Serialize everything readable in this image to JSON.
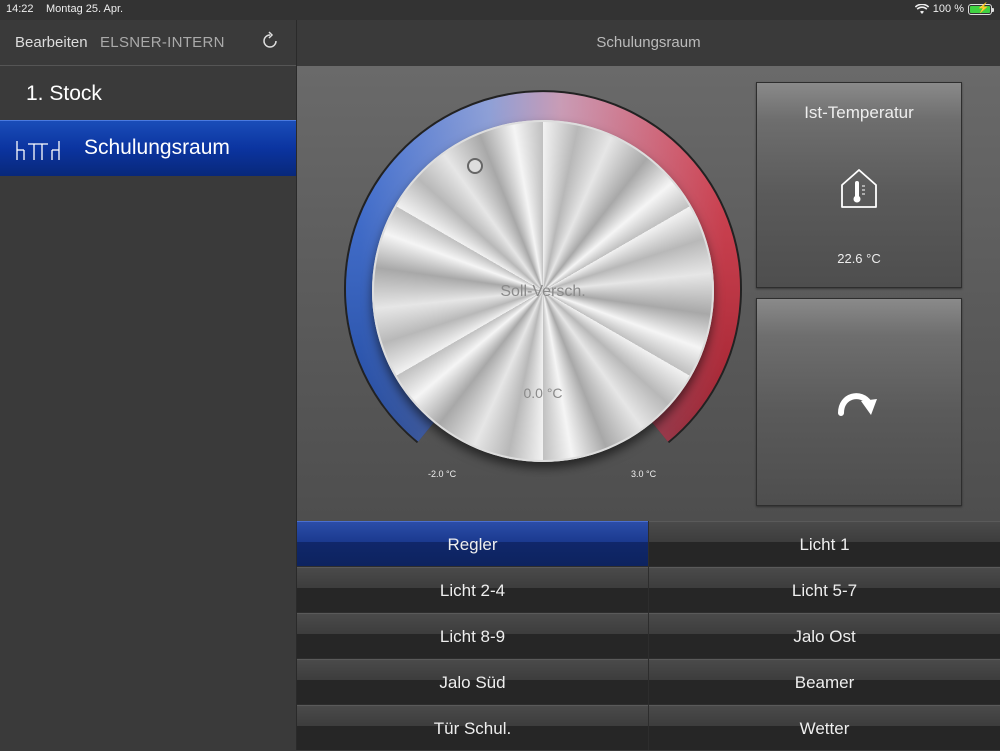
{
  "status_bar": {
    "time": "14:22",
    "date": "Montag 25. Apr.",
    "battery_text": "100 %"
  },
  "left_nav": {
    "edit_label": "Bearbeiten",
    "project_label": "ELSNER-INTERN",
    "refresh_icon": "refresh-icon"
  },
  "right_nav": {
    "title": "Schulungsraum"
  },
  "sidebar": {
    "floor": "1. Stock",
    "rooms": [
      {
        "label": "Schulungsraum",
        "icon": "room-icon",
        "selected": true
      }
    ]
  },
  "dial": {
    "label": "Soll-Versch.",
    "value": "0.0 °C",
    "min_label": "-2.0 °C",
    "max_label": "3.0 °C",
    "colors": {
      "cold": "#2a5fd0",
      "warm": "#d0283a"
    }
  },
  "tiles": {
    "temperature": {
      "label": "Ist-Temperatur",
      "value": "22.6 °C",
      "icon": "house-thermometer-icon"
    },
    "action": {
      "icon": "curved-arrow-icon"
    }
  },
  "grid": {
    "buttons": [
      {
        "label": "Regler",
        "active": true
      },
      {
        "label": "Licht 1",
        "active": false
      },
      {
        "label": "Licht 2-4",
        "active": false
      },
      {
        "label": "Licht 5-7",
        "active": false
      },
      {
        "label": "Licht 8-9",
        "active": false
      },
      {
        "label": "Jalo Ost",
        "active": false
      },
      {
        "label": "Jalo Süd",
        "active": false
      },
      {
        "label": "Beamer",
        "active": false
      },
      {
        "label": "Tür Schul.",
        "active": false
      },
      {
        "label": "Wetter",
        "active": false
      }
    ]
  }
}
